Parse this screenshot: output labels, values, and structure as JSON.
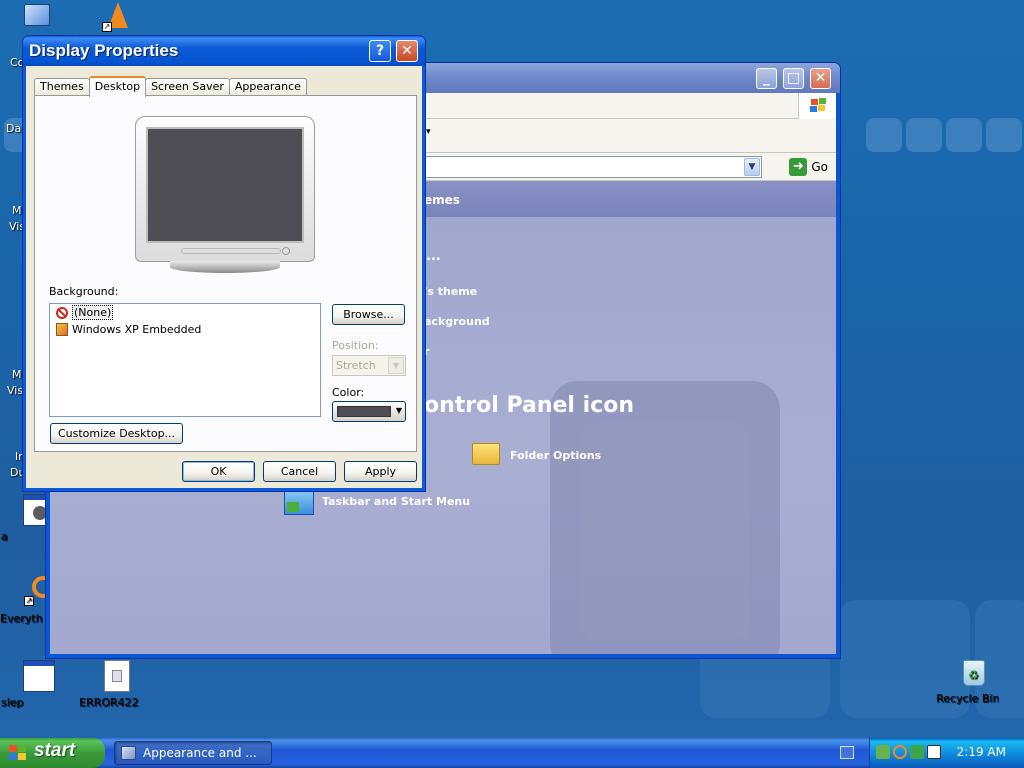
{
  "desktop": {
    "icons": [
      {
        "label": "slep"
      },
      {
        "label": "ERROR422"
      },
      {
        "label": "Recycle Bin"
      },
      {
        "label": "a"
      },
      {
        "label": "Everyth"
      }
    ],
    "clipped_labels": [
      "Co",
      "Da",
      "M",
      "Vis",
      "M",
      "Vis",
      "In",
      "Du"
    ]
  },
  "control_panel": {
    "go_label": "Go",
    "header_text": "emes",
    "task_ellipsis": "...",
    "tasks": [
      "'s theme",
      "ackground",
      "r"
    ],
    "pick_icon_text": "ontrol Panel icon",
    "items": [
      "Folder Options",
      "Taskbar and Start Menu"
    ]
  },
  "dialog": {
    "title": "Display Properties",
    "help_glyph": "?",
    "close_glyph": "✕",
    "tabs": [
      "Themes",
      "Desktop",
      "Screen Saver",
      "Appearance"
    ],
    "active_tab": "Desktop",
    "background_label": "Background:",
    "background_items": [
      "(None)",
      "Windows XP Embedded"
    ],
    "selected_background": "(None)",
    "browse_label": "Browse...",
    "position_label": "Position:",
    "position_value": "Stretch",
    "color_label": "Color:",
    "color_value": "#4f4e55",
    "customize_label": "Customize Desktop...",
    "ok_label": "OK",
    "cancel_label": "Cancel",
    "apply_label": "Apply"
  },
  "taskbar": {
    "start_label": "start",
    "task_item": "Appearance and ...",
    "time": "2:19 AM"
  }
}
